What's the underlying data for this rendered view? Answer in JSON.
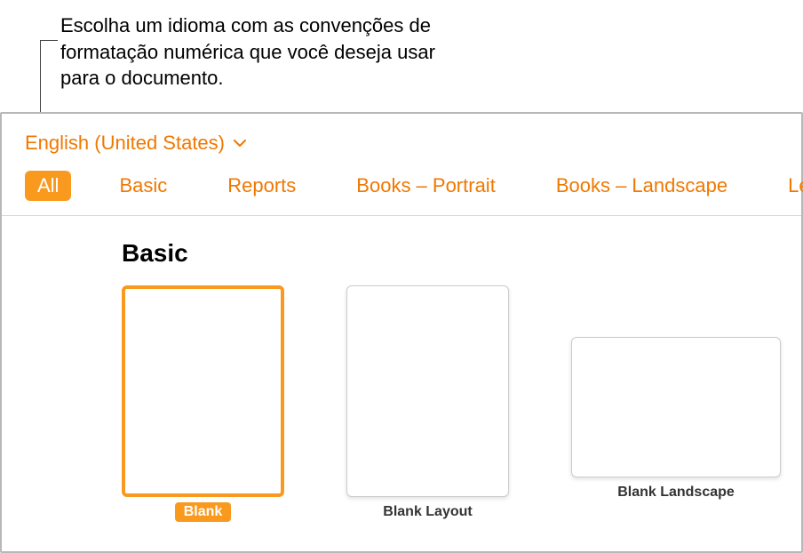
{
  "annotation": {
    "text": "Escolha um idioma com as convenções de formatação numérica que você deseja usar para o documento."
  },
  "language": {
    "selected": "English (United States)"
  },
  "tabs": {
    "items": [
      {
        "label": "All",
        "active": true
      },
      {
        "label": "Basic",
        "active": false
      },
      {
        "label": "Reports",
        "active": false
      },
      {
        "label": "Books – Portrait",
        "active": false
      },
      {
        "label": "Books – Landscape",
        "active": false
      },
      {
        "label": "Letters",
        "active": false
      }
    ]
  },
  "section": {
    "title": "Basic"
  },
  "templates": {
    "items": [
      {
        "label": "Blank",
        "selected": true,
        "shape": "portrait"
      },
      {
        "label": "Blank Layout",
        "selected": false,
        "shape": "portrait"
      },
      {
        "label": "Blank Landscape",
        "selected": false,
        "shape": "landscape"
      }
    ]
  },
  "colors": {
    "accent": "#f99a1e",
    "accent_text": "#f07800"
  }
}
